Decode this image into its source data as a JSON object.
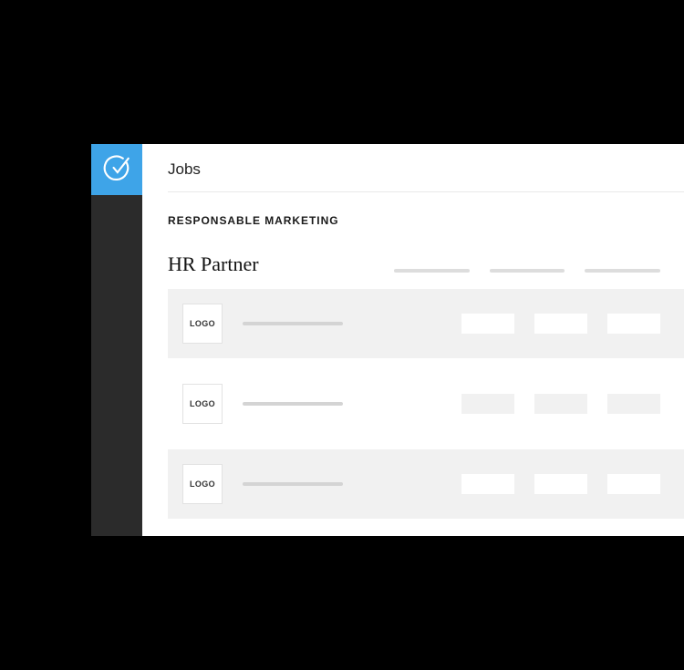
{
  "page_title": "Jobs",
  "job_title": "RESPONSABLE MARKETING",
  "section_title": "HR Partner",
  "logo_label": "LOGO",
  "colors": {
    "accent": "#3ea4e8",
    "sidebar": "#2b2b2b"
  },
  "column_headers": [
    "",
    "",
    ""
  ],
  "rows": [
    {
      "logo": "LOGO",
      "highlighted": true
    },
    {
      "logo": "LOGO",
      "highlighted": false
    },
    {
      "logo": "LOGO",
      "highlighted": true
    }
  ]
}
